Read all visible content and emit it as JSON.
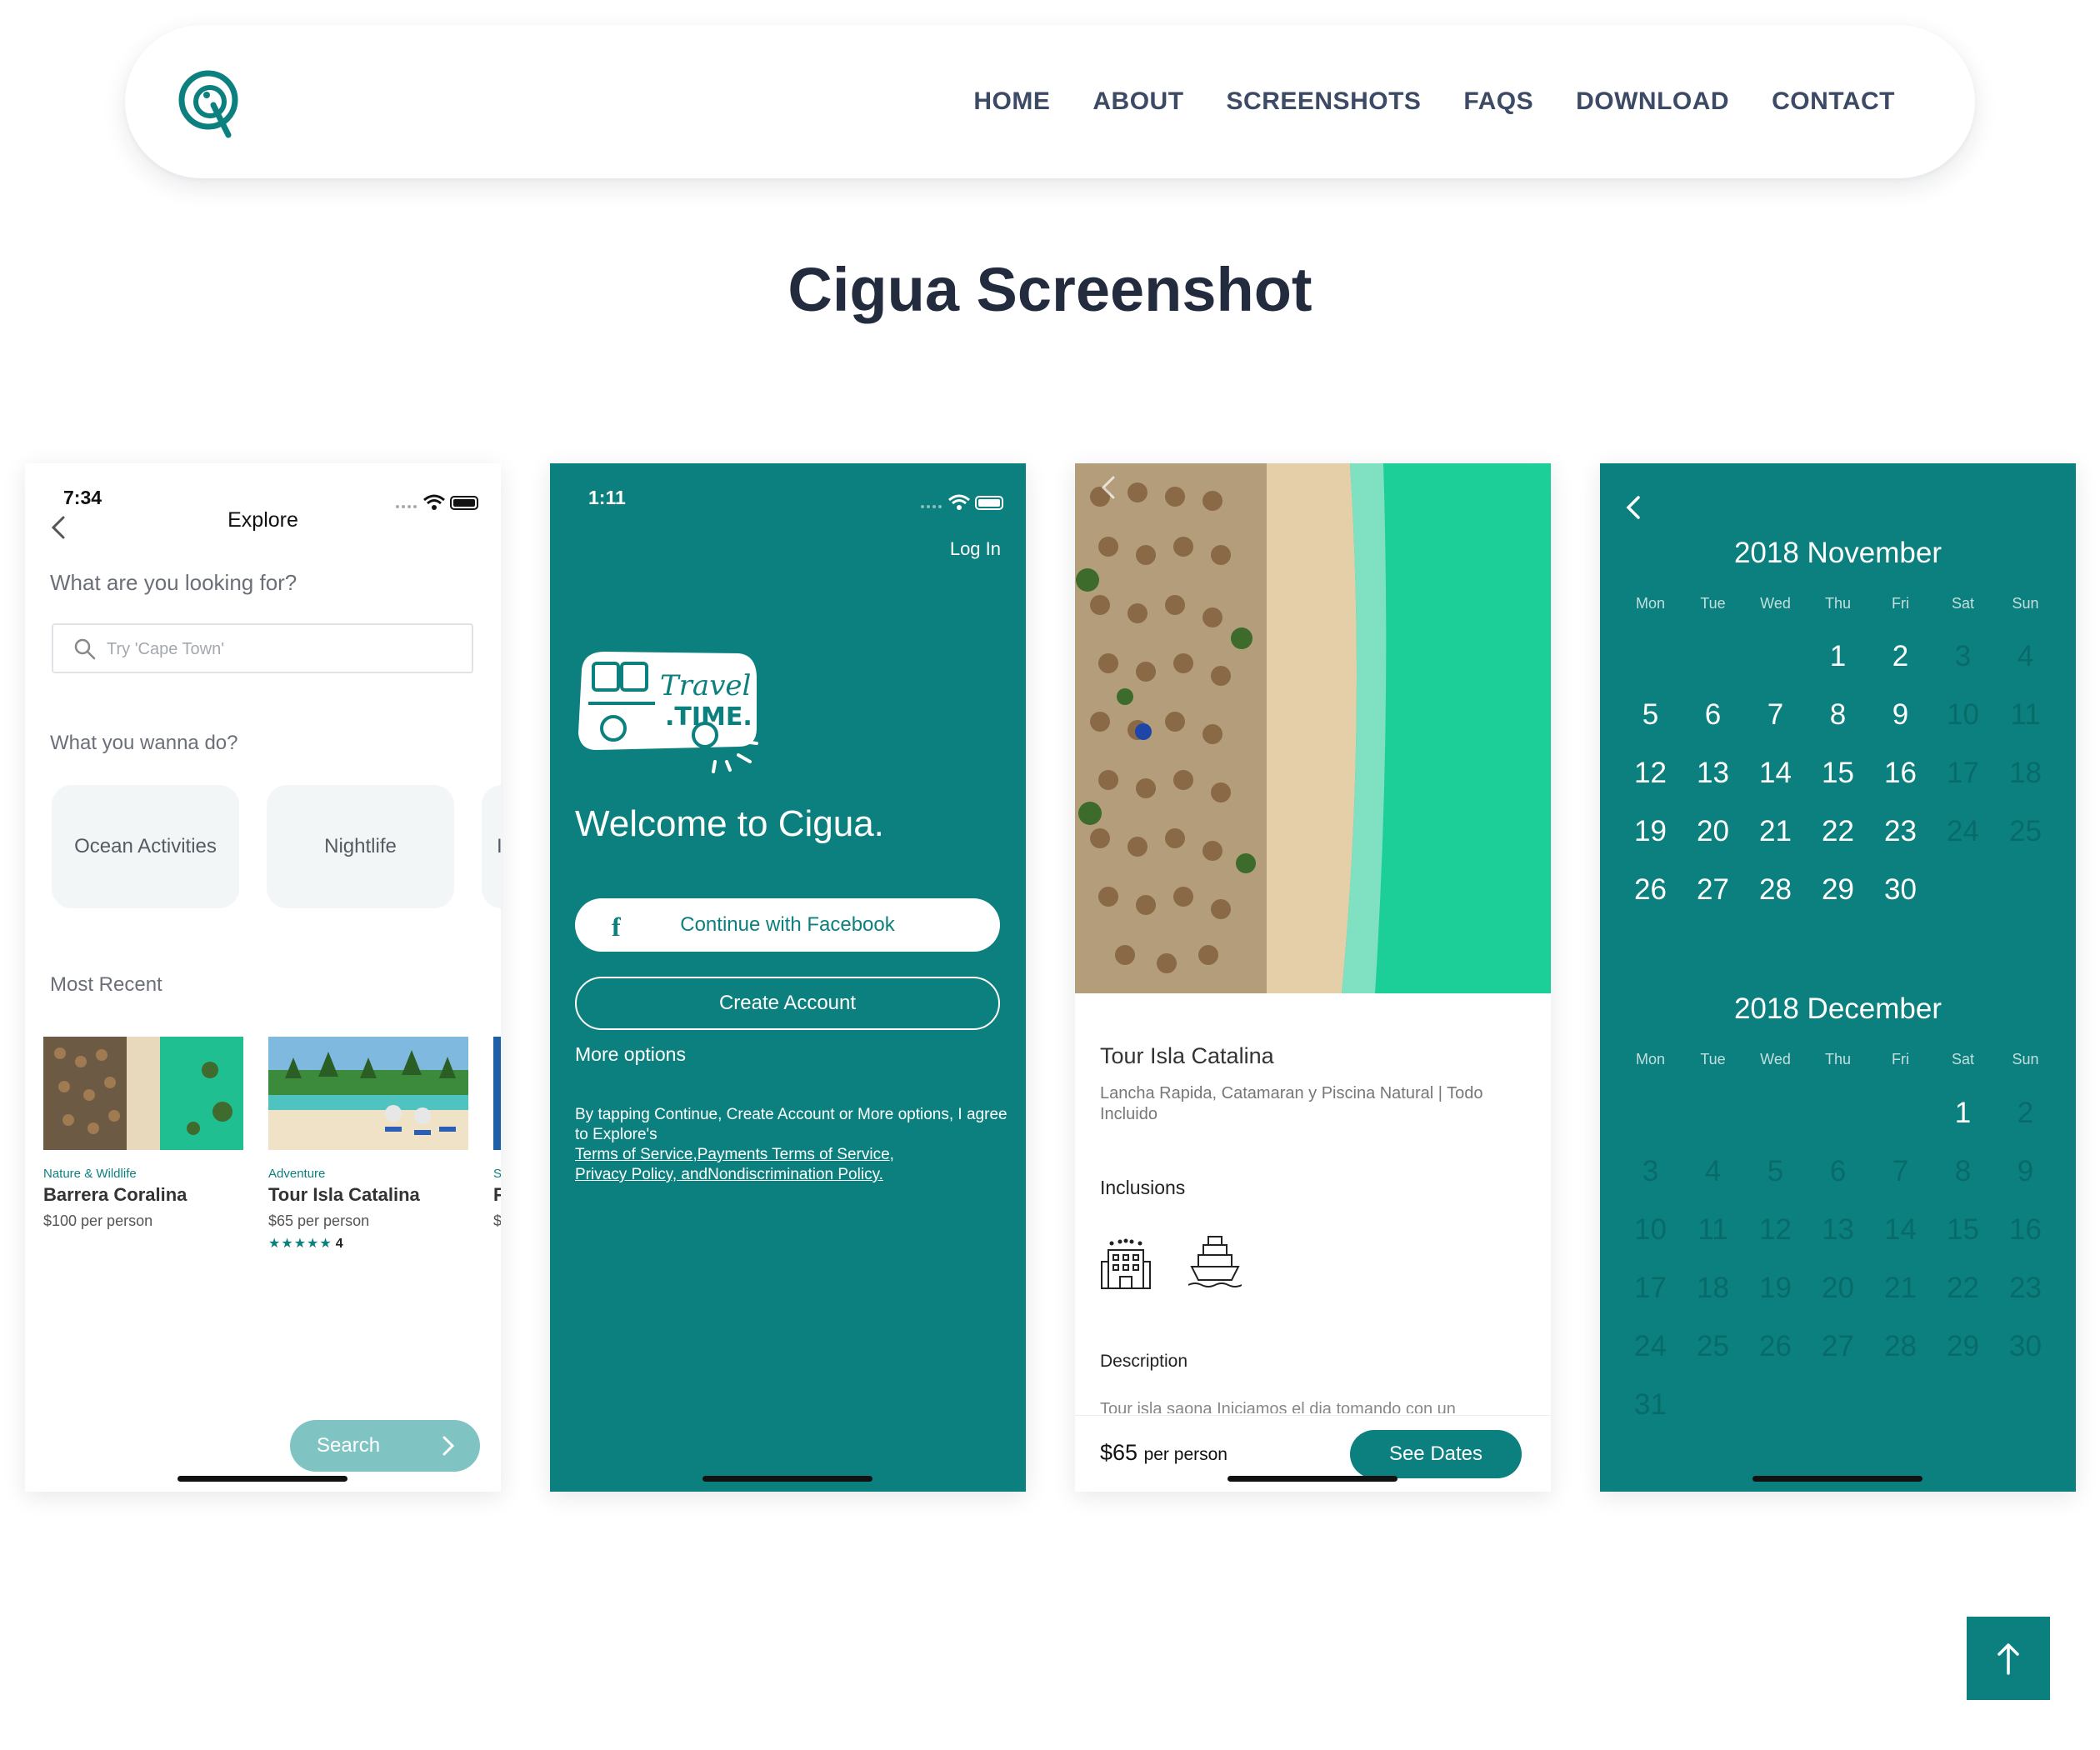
{
  "nav": {
    "links": [
      "HOME",
      "ABOUT",
      "SCREENSHOTS",
      "FAQS",
      "DOWNLOAD",
      "CONTACT"
    ]
  },
  "page_title": "Cigua Screenshot",
  "phone1": {
    "time": "7:34",
    "title": "Explore",
    "question": "What are you looking for?",
    "search_placeholder": "Try 'Cape Town'",
    "wanna": "What you wanna do?",
    "chips": [
      "Ocean Activities",
      "Nightlife",
      "I"
    ],
    "most_recent": "Most Recent",
    "cards": [
      {
        "tag": "Nature & Wildlife",
        "name": "Barrera Coralina",
        "price": "$100 per person"
      },
      {
        "tag": "Adventure",
        "name": "Tour Isla Catalina",
        "price": "$65 per person",
        "stars": "★★★★★",
        "rating": "4"
      },
      {
        "tag": "S",
        "name": "F",
        "price": "$"
      }
    ],
    "search_button": "Search"
  },
  "phone2": {
    "time": "1:11",
    "login": "Log In",
    "welcome": "Welcome to Cigua.",
    "facebook_button": "Continue with Facebook",
    "create_button": "Create Account",
    "more_options": "More options",
    "legal_text": "By tapping Continue, Create Account or More options, I agree to Explore's",
    "legal_link1": "Terms of Service,Payments Terms of Service,",
    "legal_link2": "Privacy Policy, andNondiscrimination Policy."
  },
  "phone3": {
    "title": "Tour Isla Catalina",
    "subtitle": "Lancha Rapida, Catamaran y Piscina Natural | Todo Incluido",
    "inclusions": "Inclusions",
    "description": "Description",
    "description_text": "Tour isla saona Iniciamos el dia tomando con un",
    "price": "$65",
    "price_unit": "per person",
    "dates_button": "See Dates"
  },
  "phone4": {
    "months": [
      {
        "title": "2018 November"
      },
      {
        "title": "2018 December"
      }
    ],
    "weekdays": [
      "Mon",
      "Tue",
      "Wed",
      "Thu",
      "Fri",
      "Sat",
      "Sun"
    ]
  },
  "colors": {
    "accent": "#0c807e",
    "text_dark": "#232b3f",
    "nav_text": "#3d4a66"
  },
  "icons": {
    "scroll_top": "arrow-up-icon"
  }
}
